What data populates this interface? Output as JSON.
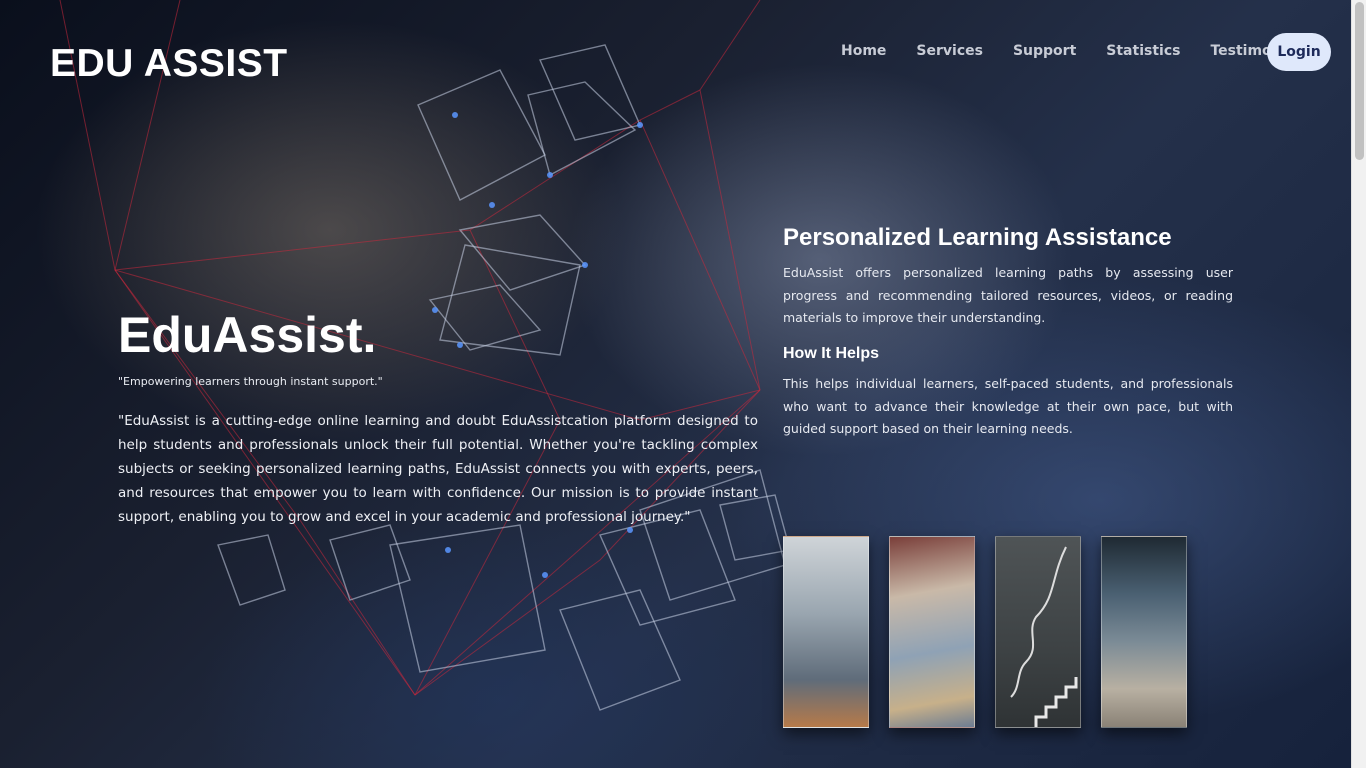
{
  "header": {
    "logo": "EDU ASSIST",
    "nav": [
      "Home",
      "Services",
      "Support",
      "Statistics",
      "Testimonials"
    ],
    "login_label": "Login"
  },
  "hero": {
    "title": "EduAssist.",
    "tagline": "\"Empowering learners through instant support.\"",
    "description": "\"EduAssist is a cutting-edge online learning and doubt EduAssistcation platform designed to help students and professionals unlock their full potential. Whether you're tackling complex subjects or seeking personalized learning paths, EduAssist connects you with experts, peers, and resources that empower you to learn with confidence. Our mission is to provide instant support, enabling you to grow and excel in your academic and professional journey.\""
  },
  "feature": {
    "title": "Personalized Learning Assistance",
    "description": "EduAssist offers personalized learning paths by assessing user progress and recommending tailored resources, videos, or reading materials to improve their understanding.",
    "subtitle": "How It Helps",
    "subdescription": "This helps individual learners, self-paced students, and professionals who want to advance their knowledge at their own pace, but with guided support based on their learning needs."
  },
  "thumbnails": [
    {
      "icon": "business-person-photo"
    },
    {
      "icon": "reading-tablet-photo"
    },
    {
      "icon": "chalkboard-stairs-photo"
    },
    {
      "icon": "classroom-photo"
    }
  ]
}
